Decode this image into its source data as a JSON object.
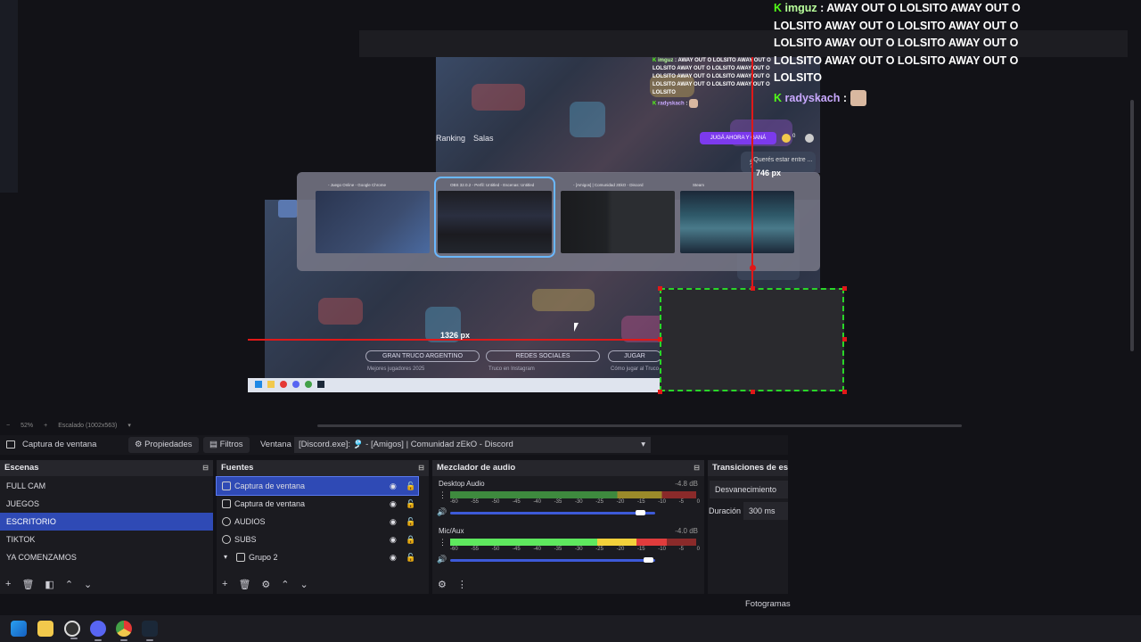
{
  "window_controls": {
    "minimize": "—",
    "maximize": "❐",
    "close": "✕"
  },
  "chat": {
    "messages": [
      {
        "user": "imguz",
        "text": ": AWAY OUT O LOLSITO AWAY OUT O LOLSITO AWAY OUT O LOLSITO AWAY OUT O LOLSITO AWAY OUT O LOLSITO AWAY OUT O LOLSITO AWAY OUT O LOLSITO AWAY OUT O LOLSITO"
      },
      {
        "user": "radyskach",
        "text": ":"
      }
    ],
    "small_messages": [
      {
        "user": "imguz",
        "text": ": AWAY OUT O LOLSITO AWAY OUT O LOLSITO AWAY OUT O LOLSITO AWAY OUT O LOLSITO AWAY OUT O LOLSITO AWAY OUT O LOLSITO AWAY OUT O LOLSITO AWAY OUT O LOLSITO"
      },
      {
        "user": "radyskach",
        "text": ":"
      }
    ]
  },
  "site": {
    "nav": [
      "Ranking",
      "Salas"
    ],
    "cta": "JUGÁ AHORA Y GANÁ",
    "coins": "0",
    "question": "¿Querés estar entre ... ?",
    "bottom_pills": [
      "GRAN TRUCO ARGENTINO",
      "REDES SOCIALES",
      "JUGAR"
    ],
    "bottom_subs": [
      "Mejores jugadores 2025",
      "Truco en Instagram",
      "Cómo jugar al Truco"
    ]
  },
  "switcher": {
    "cards": [
      {
        "title": "- Juego Online - Google Chrome"
      },
      {
        "title": "OBS 32.0.2 - Perfil: Untitled - Escenas: Untitled"
      },
      {
        "title": "- [Amigos] | Comunidad zEkO - Discord"
      },
      {
        "title": "Steam"
      }
    ]
  },
  "measure": {
    "width_label": "1326 px",
    "height_label": "746 px"
  },
  "zoom": {
    "minus": "−",
    "percent": "52%",
    "plus": "+",
    "scale_label": "Escalado (1002x563)",
    "arrow": "▾"
  },
  "context_bar": {
    "source_name": "Captura de ventana",
    "properties": "Propiedades",
    "filters": "Filtros",
    "window_label": "Ventana",
    "window_value": "[Discord.exe]: 🎐 - [Amigos] | Comunidad zEkO - Discord"
  },
  "scenes": {
    "title": "Escenas",
    "items": [
      "FULL CAM",
      "JUEGOS",
      "ESCRITORIO",
      "TIKTOK",
      "YA COMENZAMOS"
    ],
    "selected_index": 2
  },
  "sources": {
    "title": "Fuentes",
    "items": [
      "Captura de ventana",
      "Captura de ventana",
      "AUDIOS",
      "SUBS",
      "Grupo 2"
    ]
  },
  "mixer": {
    "title": "Mezclador de audio",
    "tracks": [
      {
        "name": "Desktop Audio",
        "db": "-4.8 dB",
        "level": 0.0,
        "volume": 0.93
      },
      {
        "name": "Mic/Aux",
        "db": "-4.0 dB",
        "level": 0.88,
        "volume": 0.97
      }
    ],
    "ticks": [
      "-60",
      "-55",
      "-50",
      "-45",
      "-40",
      "-35",
      "-30",
      "-25",
      "-20",
      "-15",
      "-10",
      "-5",
      "0"
    ]
  },
  "transitions": {
    "title": "Transiciones de esce",
    "type": "Desvanecimiento",
    "duration_label": "Duración",
    "duration_value": "300 ms"
  },
  "status": {
    "frames": "Fotogramas"
  },
  "colors": {
    "accent": "#2f4ab5",
    "kick_green": "#53fc18",
    "measure_red": "#e01818",
    "select_green": "#29d629"
  }
}
